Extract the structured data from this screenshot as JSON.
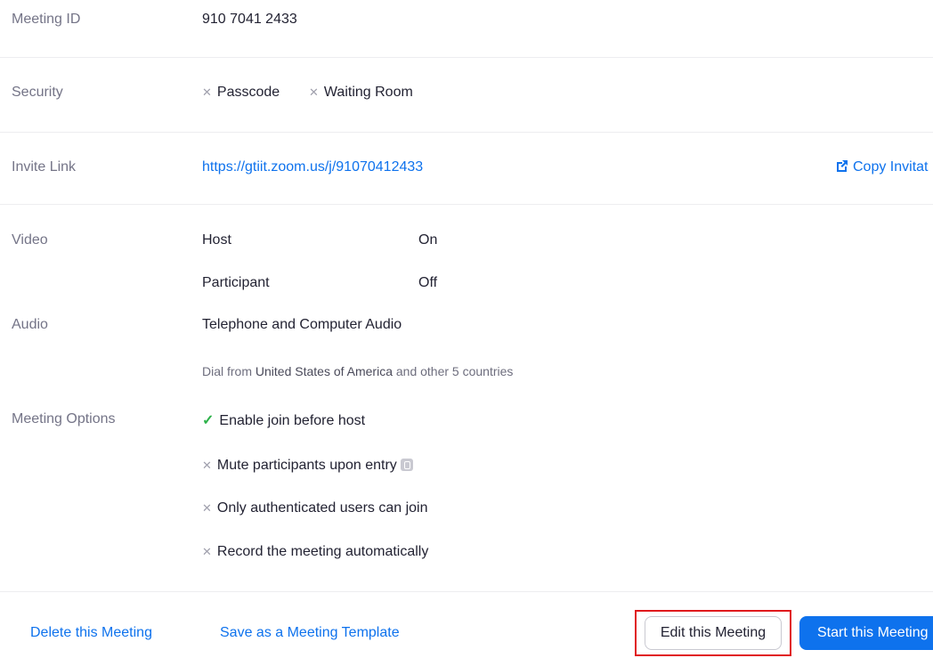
{
  "meeting_id": {
    "label": "Meeting ID",
    "value": "910 7041 2433"
  },
  "security": {
    "label": "Security",
    "options": [
      {
        "icon": "x-icon",
        "text": "Passcode"
      },
      {
        "icon": "x-icon",
        "text": "Waiting Room"
      }
    ]
  },
  "invite_link": {
    "label": "Invite Link",
    "url": "https://gtiit.zoom.us/j/91070412433",
    "copy_label": "Copy Invitat"
  },
  "video": {
    "label": "Video",
    "host_label": "Host",
    "host_value": "On",
    "participant_label": "Participant",
    "participant_value": "Off"
  },
  "audio": {
    "label": "Audio",
    "value": "Telephone and Computer Audio",
    "dial_prefix": "Dial from",
    "dial_country": "United States of America",
    "dial_suffix": "and other 5 countries"
  },
  "meeting_options": {
    "label": "Meeting Options",
    "items": [
      {
        "icon": "check-icon",
        "text": "Enable join before host"
      },
      {
        "icon": "x-icon",
        "text": "Mute participants upon entry"
      },
      {
        "icon": "x-icon",
        "text": "Only authenticated users can join"
      },
      {
        "icon": "x-icon",
        "text": "Record the meeting automatically"
      }
    ]
  },
  "footer": {
    "delete_label": "Delete this Meeting",
    "template_label": "Save as a Meeting Template",
    "edit_label": "Edit this Meeting",
    "start_label": "Start this Meeting"
  },
  "colors": {
    "accent": "#0e72ed",
    "highlight": "#e0191d",
    "check": "#2db24a"
  }
}
